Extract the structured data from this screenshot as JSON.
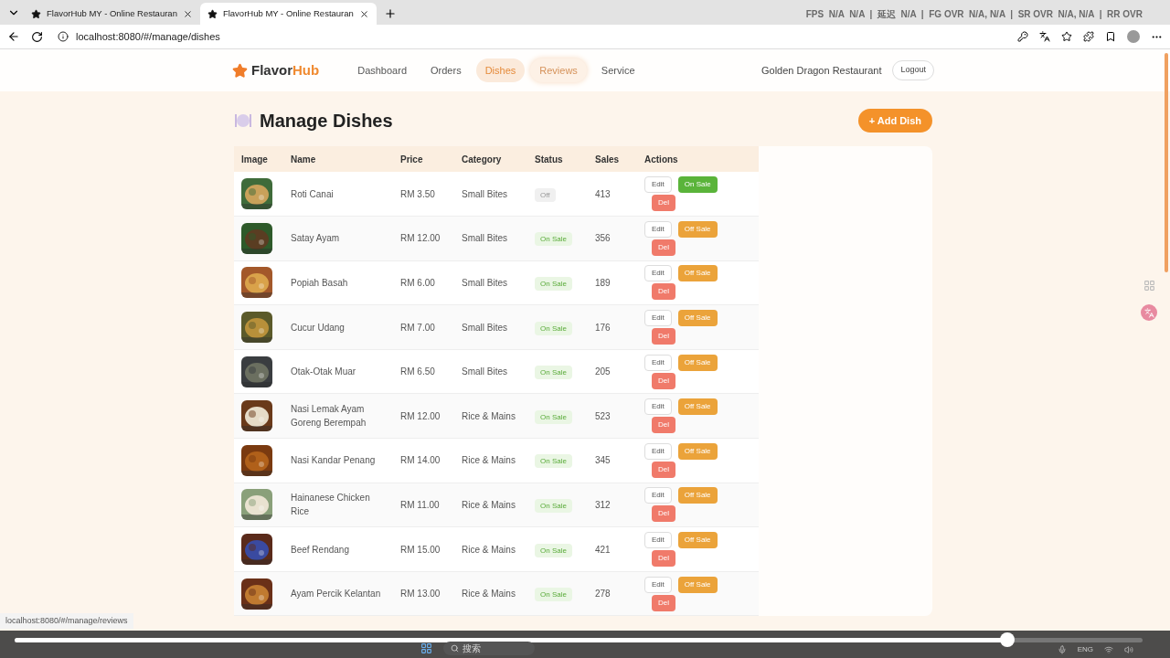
{
  "browser": {
    "tabs": [
      {
        "title": "FlavorHub MY - Online Restauran",
        "selected": false
      },
      {
        "title": "FlavorHub MY - Online Restauran",
        "selected": true
      }
    ],
    "url": "localhost:8080/#/manage/dishes",
    "overlay": "FPS  N/A  N/A  |  延迟  N/A  |  FG OVR  N/A, N/A  |  SR OVR  N/A, N/A  |  RR OVR"
  },
  "header": {
    "logo_a": "Flavor",
    "logo_b": "Hub",
    "nav": [
      {
        "label": "Dashboard",
        "selected": false,
        "hovered": false
      },
      {
        "label": "Orders",
        "selected": false,
        "hovered": false
      },
      {
        "label": "Dishes",
        "selected": true,
        "hovered": false
      },
      {
        "label": "Reviews",
        "selected": false,
        "hovered": true
      },
      {
        "label": "Service",
        "selected": false,
        "hovered": false
      }
    ],
    "restaurant": "Golden Dragon Restaurant",
    "logout": "Logout"
  },
  "page": {
    "title": "Manage Dishes",
    "add_button": "+ Add Dish"
  },
  "table": {
    "columns": [
      "Image",
      "Name",
      "Price",
      "Category",
      "Status",
      "Sales",
      "Actions"
    ],
    "rows": [
      {
        "name": "Roti Canai",
        "price": "RM 3.50",
        "category": "Small Bites",
        "status": "Off",
        "on_sale": false,
        "sales": "413",
        "edit": "Edit",
        "toggle": "On Sale",
        "del": "Del"
      },
      {
        "name": "Satay Ayam",
        "price": "RM 12.00",
        "category": "Small Bites",
        "status": "On Sale",
        "on_sale": true,
        "sales": "356",
        "edit": "Edit",
        "toggle": "Off Sale",
        "del": "Del"
      },
      {
        "name": "Popiah Basah",
        "price": "RM 6.00",
        "category": "Small Bites",
        "status": "On Sale",
        "on_sale": true,
        "sales": "189",
        "edit": "Edit",
        "toggle": "Off Sale",
        "del": "Del"
      },
      {
        "name": "Cucur Udang",
        "price": "RM 7.00",
        "category": "Small Bites",
        "status": "On Sale",
        "on_sale": true,
        "sales": "176",
        "edit": "Edit",
        "toggle": "Off Sale",
        "del": "Del"
      },
      {
        "name": "Otak-Otak Muar",
        "price": "RM 6.50",
        "category": "Small Bites",
        "status": "On Sale",
        "on_sale": true,
        "sales": "205",
        "edit": "Edit",
        "toggle": "Off Sale",
        "del": "Del"
      },
      {
        "name": "Nasi Lemak Ayam Goreng Berempah",
        "price": "RM 12.00",
        "category": "Rice & Mains",
        "status": "On Sale",
        "on_sale": true,
        "sales": "523",
        "edit": "Edit",
        "toggle": "Off Sale",
        "del": "Del"
      },
      {
        "name": "Nasi Kandar Penang",
        "price": "RM 14.00",
        "category": "Rice & Mains",
        "status": "On Sale",
        "on_sale": true,
        "sales": "345",
        "edit": "Edit",
        "toggle": "Off Sale",
        "del": "Del"
      },
      {
        "name": "Hainanese Chicken Rice",
        "price": "RM 11.00",
        "category": "Rice & Mains",
        "status": "On Sale",
        "on_sale": true,
        "sales": "312",
        "edit": "Edit",
        "toggle": "Off Sale",
        "del": "Del"
      },
      {
        "name": "Beef Rendang",
        "price": "RM 15.00",
        "category": "Rice & Mains",
        "status": "On Sale",
        "on_sale": true,
        "sales": "421",
        "edit": "Edit",
        "toggle": "Off Sale",
        "del": "Del"
      },
      {
        "name": "Ayam Percik Kelantan",
        "price": "RM 13.00",
        "category": "Rice & Mains",
        "status": "On Sale",
        "on_sale": true,
        "sales": "278",
        "edit": "Edit",
        "toggle": "Off Sale",
        "del": "Del"
      }
    ]
  },
  "status_link": "localhost:8080/#/manage/reviews",
  "video": {
    "level": 0.88
  },
  "taskbar": {
    "search": "搜索",
    "lang": "ENG"
  }
}
